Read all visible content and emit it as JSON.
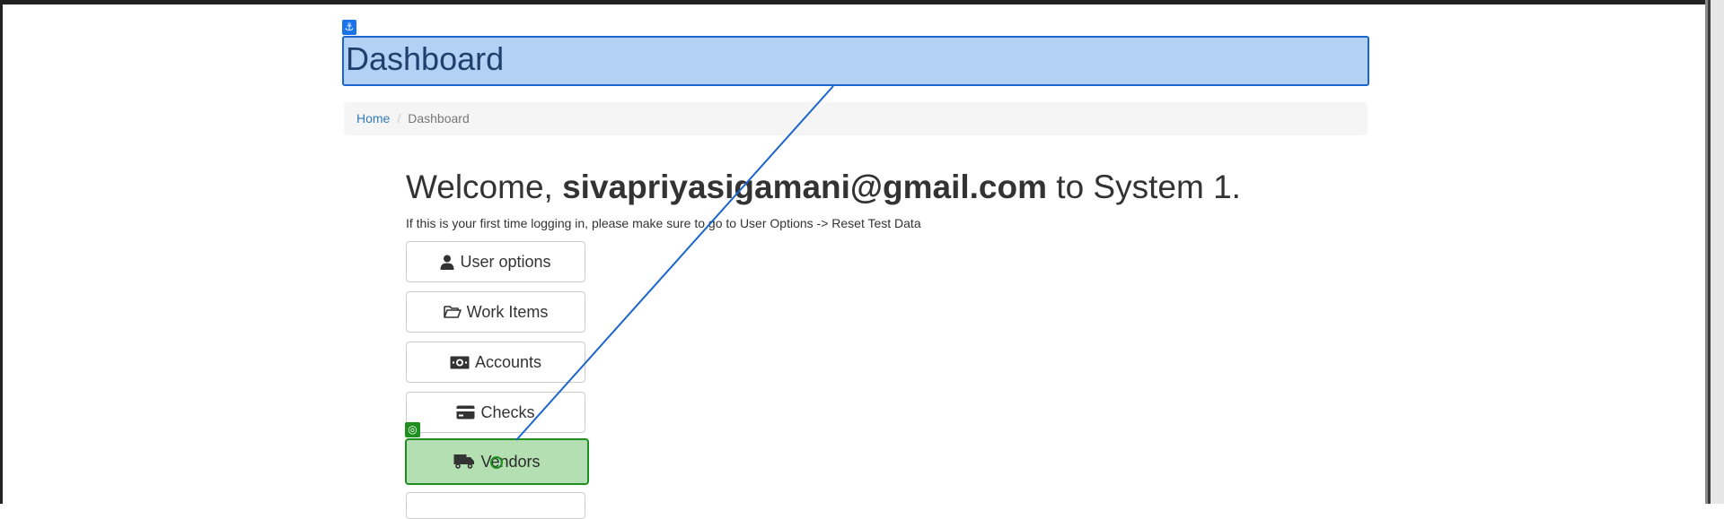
{
  "header": {
    "title": "Dashboard",
    "anchor_glyph": "⚓"
  },
  "breadcrumb": {
    "home": "Home",
    "separator": "/",
    "current": "Dashboard"
  },
  "welcome": {
    "prefix": "Welcome, ",
    "email": "sivapriyasigamani@gmail.com",
    "suffix": " to System 1."
  },
  "hint": "If this is your first time logging in, please make sure to go to User Options -> Reset Test Data",
  "menu": [
    {
      "label": "User options",
      "icon": "user-icon"
    },
    {
      "label": "Work Items",
      "icon": "folder-open-icon"
    },
    {
      "label": "Accounts",
      "icon": "money-bill-icon"
    },
    {
      "label": "Checks",
      "icon": "credit-card-icon"
    },
    {
      "label": "Vendors",
      "icon": "truck-icon"
    }
  ],
  "target_glyph": "◎",
  "colors": {
    "anchor": "#1a73e8",
    "header_highlight": "#b3d1f5",
    "target": "#1e8e1e",
    "target_highlight": "#b3dfb3",
    "link": "#337ab7"
  }
}
